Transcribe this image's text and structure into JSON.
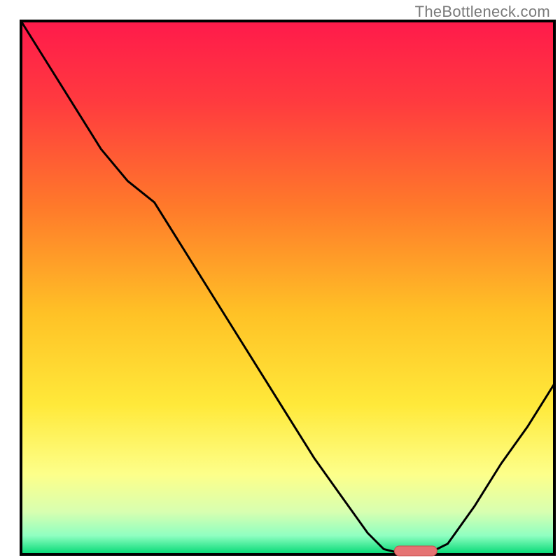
{
  "watermark": "TheBottleneck.com",
  "chart_data": {
    "type": "line",
    "title": "",
    "xlabel": "",
    "ylabel": "",
    "xlim": [
      0,
      100
    ],
    "ylim": [
      0,
      100
    ],
    "series": [
      {
        "name": "bottleneck-curve",
        "x": [
          0,
          5,
          10,
          15,
          20,
          25,
          30,
          35,
          40,
          45,
          50,
          55,
          60,
          65,
          68,
          72,
          76,
          80,
          85,
          90,
          95,
          100
        ],
        "y": [
          100,
          92,
          84,
          76,
          70,
          66,
          58,
          50,
          42,
          34,
          26,
          18,
          11,
          4,
          1,
          0,
          0,
          2,
          9,
          17,
          24,
          32
        ]
      }
    ],
    "optimal_marker": {
      "x_start": 70,
      "x_end": 78,
      "y": 0
    },
    "gradient_stops": [
      {
        "offset": 0.0,
        "color": "#ff1a4b"
      },
      {
        "offset": 0.15,
        "color": "#ff3a3f"
      },
      {
        "offset": 0.35,
        "color": "#ff7a2a"
      },
      {
        "offset": 0.55,
        "color": "#ffc226"
      },
      {
        "offset": 0.72,
        "color": "#ffe93a"
      },
      {
        "offset": 0.85,
        "color": "#fdff8a"
      },
      {
        "offset": 0.92,
        "color": "#d8ffb0"
      },
      {
        "offset": 0.965,
        "color": "#8fffc1"
      },
      {
        "offset": 1.0,
        "color": "#00d873"
      }
    ],
    "border_color": "#000000",
    "marker_fill": "#e57373",
    "marker_stroke": "#c94b4b"
  }
}
